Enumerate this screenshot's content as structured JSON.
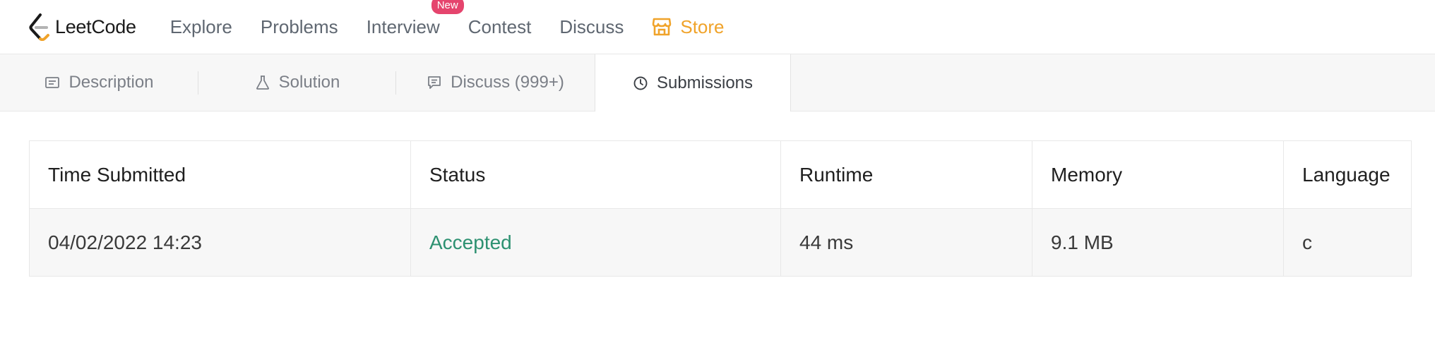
{
  "nav": {
    "logo_text": "LeetCode",
    "items": [
      {
        "label": "Explore"
      },
      {
        "label": "Problems"
      },
      {
        "label": "Interview",
        "badge": "New"
      },
      {
        "label": "Contest"
      },
      {
        "label": "Discuss"
      },
      {
        "label": "Store",
        "icon": "store-icon"
      }
    ],
    "logo_colors": {
      "bracket": "#1a1a1a",
      "accent": "#f0a32a",
      "dash": "#b3b3b3"
    },
    "store_color": "#f0a32a",
    "badge_color": "#e5446d"
  },
  "tabs": [
    {
      "label": "Description",
      "icon": "description-icon"
    },
    {
      "label": "Solution",
      "icon": "flask-icon"
    },
    {
      "label": "Discuss (999+)",
      "icon": "comment-icon"
    },
    {
      "label": "Submissions",
      "icon": "clock-icon",
      "active": true
    }
  ],
  "submissions": {
    "columns": [
      "Time Submitted",
      "Status",
      "Runtime",
      "Memory",
      "Language"
    ],
    "rows": [
      {
        "time": "04/02/2022 14:23",
        "status": "Accepted",
        "runtime": "44 ms",
        "memory": "9.1 MB",
        "language": "c"
      }
    ],
    "accepted_color": "#2d9171"
  }
}
